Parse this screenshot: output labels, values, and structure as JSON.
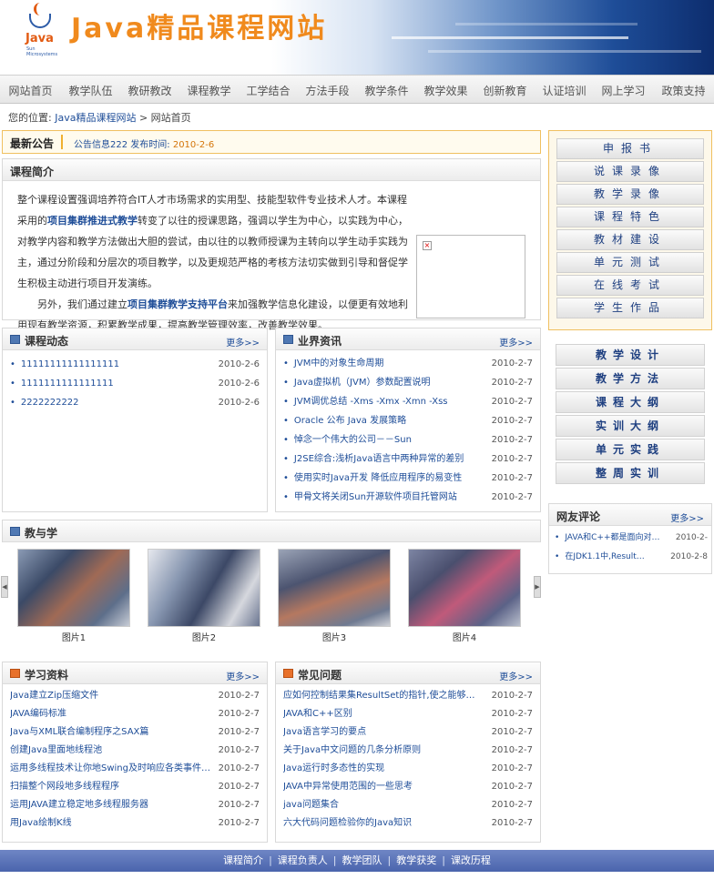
{
  "header": {
    "logo_text": "Java",
    "logo_sub": "Sun Microsystems",
    "site_title": "Java精品课程网站"
  },
  "nav": {
    "items": [
      "网站首页",
      "教学队伍",
      "教研教改",
      "课程教学",
      "工学结合",
      "方法手段",
      "教学条件",
      "教学效果",
      "创新教育",
      "认证培训",
      "网上学习",
      "政策支持"
    ]
  },
  "breadcrumb": {
    "prefix": "您的位置:",
    "site": "Java精品课程网站",
    "current": "> 网站首页"
  },
  "notice": {
    "label": "最新公告",
    "text": "公告信息222 发布时间:",
    "date": "2010-2-6"
  },
  "intro": {
    "title": "课程简介",
    "p1_a": "整个课程设置强调培养符合IT人才市场需求的实用型、技能型软件专业技术人才。本课程采用的",
    "p1_b": "项目集群推进式教学",
    "p1_c": "转变了以往的授课思路，强调以学生为中心，以实践为中心，对教学内容和教学方法做出大胆的尝试，由以往的以教师授课为主转向以学生动手实践为主，通过分阶段和分层次的项目教学，以及更规范严格的考核方法切实做到引导和督促学生积极主动进行项目开发演练。",
    "p2_a": "另外，我们通过建立",
    "p2_b": "项目集群教学支持平台",
    "p2_c": "来加强教学信息化建设，以便更有效地利用现有教学资源，积累教学成果，提高教学管理效率，改善教学效果。"
  },
  "course_news": {
    "title": "课程动态",
    "more": "更多>>",
    "items": [
      {
        "text": "11111111111111111",
        "date": "2010-2-6"
      },
      {
        "text": "1111111111111111",
        "date": "2010-2-6"
      },
      {
        "text": "2222222222",
        "date": "2010-2-6"
      }
    ]
  },
  "industry_news": {
    "title": "业界资讯",
    "more": "更多>>",
    "items": [
      {
        "text": "JVM中的对象生命周期",
        "date": "2010-2-7"
      },
      {
        "text": "Java虚拟机（JVM）参数配置说明",
        "date": "2010-2-7"
      },
      {
        "text": "JVM调优总结 -Xms -Xmx -Xmn -Xss",
        "date": "2010-2-7"
      },
      {
        "text": "Oracle 公布 Java 发展策略",
        "date": "2010-2-7"
      },
      {
        "text": "悼念一个伟大的公司－－Sun",
        "date": "2010-2-7"
      },
      {
        "text": "J2SE综合:浅析Java语言中两种异常的差别",
        "date": "2010-2-7"
      },
      {
        "text": "使用实时Java开发 降低应用程序的易变性",
        "date": "2010-2-7"
      },
      {
        "text": "甲骨文将关闭Sun开源软件项目托管网站",
        "date": "2010-2-7"
      }
    ]
  },
  "teach_learn": {
    "title": "教与学",
    "captions": [
      "图片1",
      "图片2",
      "图片3",
      "图片4"
    ]
  },
  "study_materials": {
    "title": "学习资料",
    "more": "更多>>",
    "items": [
      {
        "text": "Java建立Zip压缩文件",
        "date": "2010-2-7"
      },
      {
        "text": "JAVA编码标准",
        "date": "2010-2-7"
      },
      {
        "text": "Java与XML联合编制程序之SAX篇",
        "date": "2010-2-7"
      },
      {
        "text": "创建Java里面地线程池",
        "date": "2010-2-7"
      },
      {
        "text": "运用多线程技术让你地Swing及时响应各类事件…",
        "date": "2010-2-7"
      },
      {
        "text": "扫描整个网段地多线程程序",
        "date": "2010-2-7"
      },
      {
        "text": "运用JAVA建立稳定地多线程服务器",
        "date": "2010-2-7"
      },
      {
        "text": "用Java绘制K线",
        "date": "2010-2-7"
      }
    ]
  },
  "faq": {
    "title": "常见问题",
    "more": "更多>>",
    "items": [
      {
        "text": "应如何控制结果集ResultSet的指针,使之能够…",
        "date": "2010-2-7"
      },
      {
        "text": "JAVA和C++区别",
        "date": "2010-2-7"
      },
      {
        "text": "Java语言学习的要点",
        "date": "2010-2-7"
      },
      {
        "text": "关于Java中文问题的几条分析原则",
        "date": "2010-2-7"
      },
      {
        "text": "Java运行时多态性的实现",
        "date": "2010-2-7"
      },
      {
        "text": "JAVA中异常使用范围的一些思考",
        "date": "2010-2-7"
      },
      {
        "text": "java问题集合",
        "date": "2010-2-7"
      },
      {
        "text": "六大代码问题检验你的Java知识",
        "date": "2010-2-7"
      }
    ]
  },
  "side_menu1": [
    "申报书",
    "说课录像",
    "教学录像",
    "课程特色",
    "教材建设",
    "单元测试",
    "在线考试",
    "学生作品"
  ],
  "side_menu2": [
    "教学设计",
    "教学方法",
    "课程大纲",
    "实训大纲",
    "单元实践",
    "整周实训"
  ],
  "comments": {
    "title": "网友评论",
    "more": "更多>>",
    "items": [
      {
        "text": "JAVA和C++都是面向对…",
        "date": "2010-2-"
      },
      {
        "text": "在JDK1.1中,Result…",
        "date": "2010-2-8"
      }
    ]
  },
  "footer": {
    "links": [
      "课程简介",
      "课程负责人",
      "教学团队",
      "教学获奖",
      "课改历程"
    ]
  }
}
